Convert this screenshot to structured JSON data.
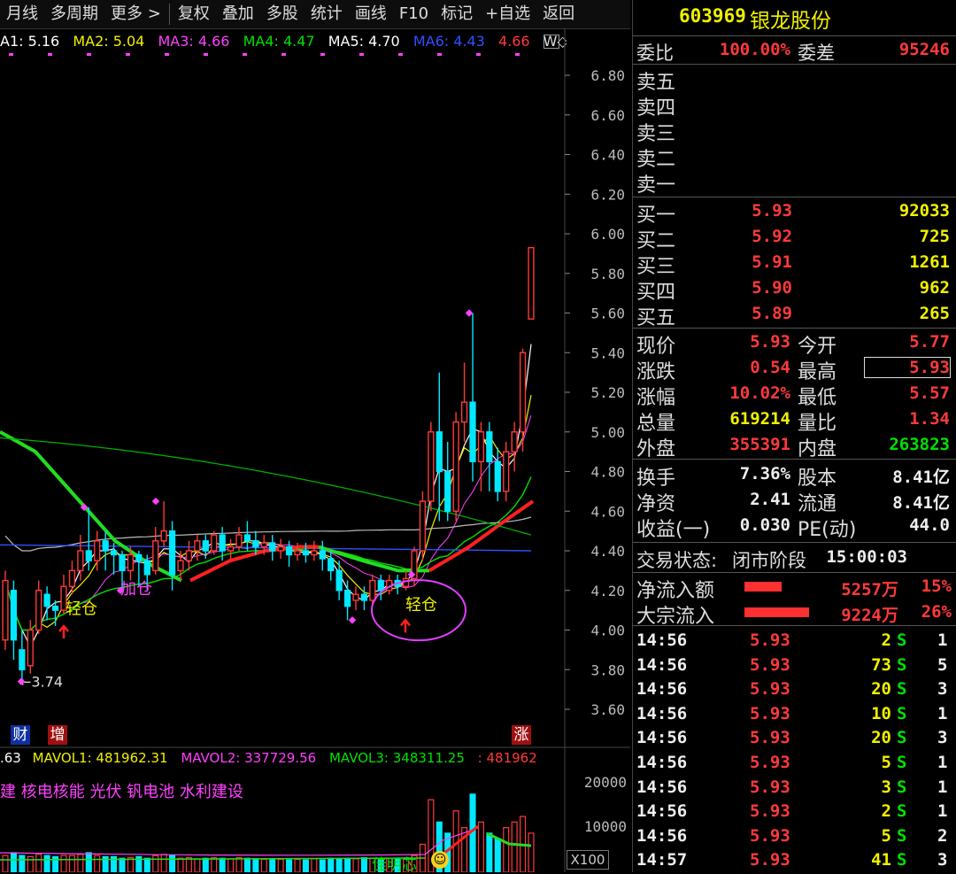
{
  "toolbar": {
    "items": [
      "月线",
      "多周期",
      "更多 >",
      "复权",
      "叠加",
      "多股",
      "统计",
      "画线",
      "F10",
      "标记",
      "+自选",
      "返回"
    ]
  },
  "ma_row": {
    "ma1": "A1: 5.16",
    "ma2": "MA2: 5.04",
    "ma3": "MA3: 4.66",
    "ma4": "MA4: 4.47",
    "ma5": "MA5: 4.70",
    "ma6": "MA6: 4.43",
    "ma7": "4.66",
    "more": "W◇",
    "colors": {
      "ma1": "#ffffff",
      "ma2": "#f0f000",
      "ma3": "#ff40ff",
      "ma4": "#00e000",
      "ma5": "#ffffff",
      "ma6": "#3050ff",
      "ma7": "#ff3a3a"
    }
  },
  "price_axis": [
    "6.80",
    "6.60",
    "6.40",
    "6.20",
    "6.00",
    "5.80",
    "5.60",
    "5.40",
    "5.20",
    "5.00",
    "4.80",
    "4.60",
    "4.40",
    "4.20",
    "4.00",
    "3.80",
    "3.60"
  ],
  "annotations": {
    "low_price": "←3.74",
    "light1": "轻仓",
    "add": "加仓",
    "light2": "轻仓",
    "badge_cai": "财",
    "badge_zeng": "增",
    "badge_zhang": "涨"
  },
  "volume": {
    "mavol_prefix": ".63",
    "mavol1": "MAVOL1: 481962.31",
    "mavol2": "MAVOL2: 337729.56",
    "mavol3": "MAVOL3: 348311.25",
    "mavol4": ": 481962",
    "concepts": "建 核电核能 光伏 钒电池 水利建设",
    "axis_top": "20000",
    "axis_mid": "10000",
    "axis_unit": "X100",
    "bottom_text": "佳明芯"
  },
  "stock": {
    "code": "603969",
    "name": "银龙股份"
  },
  "order_ratio": {
    "wei_bi_label": "委比",
    "wei_bi": "100.00%",
    "wei_cha_label": "委差",
    "wei_cha": "95246"
  },
  "asks": [
    {
      "label": "卖五",
      "price": "",
      "vol": ""
    },
    {
      "label": "卖四",
      "price": "",
      "vol": ""
    },
    {
      "label": "卖三",
      "price": "",
      "vol": ""
    },
    {
      "label": "卖二",
      "price": "",
      "vol": ""
    },
    {
      "label": "卖一",
      "price": "",
      "vol": ""
    }
  ],
  "bids": [
    {
      "label": "买一",
      "price": "5.93",
      "vol": "92033"
    },
    {
      "label": "买二",
      "price": "5.92",
      "vol": "725"
    },
    {
      "label": "买三",
      "price": "5.91",
      "vol": "1261"
    },
    {
      "label": "买四",
      "price": "5.90",
      "vol": "962"
    },
    {
      "label": "买五",
      "price": "5.89",
      "vol": "265"
    }
  ],
  "quote": {
    "xj_l": "现价",
    "xj": "5.93",
    "jk_l": "今开",
    "jk": "5.77",
    "zd_l": "涨跌",
    "zd": "0.54",
    "zg_l": "最高",
    "zg": "5.93",
    "zf_l": "涨幅",
    "zf": "10.02%",
    "zdi_l": "最低",
    "zdi": "5.57",
    "zl_l": "总量",
    "zl": "619214",
    "lb_l": "量比",
    "lb": "1.34",
    "wp_l": "外盘",
    "wp": "355391",
    "np_l": "内盘",
    "np": "263823"
  },
  "fund": {
    "hs_l": "换手",
    "hs": "7.36%",
    "gb_l": "股本",
    "gb": "8.41亿",
    "jz_l": "净资",
    "jz": "2.41",
    "lt_l": "流通",
    "lt": "8.41亿",
    "sy_l": "收益(一)",
    "sy": "0.030",
    "pe_l": "PE(动)",
    "pe": "44.0"
  },
  "trade_status": {
    "label": "交易状态:",
    "state": "闭市阶段",
    "time": "15:00:03"
  },
  "flows": [
    {
      "label": "净流入额",
      "amount": "5257万",
      "pct": "15%",
      "bar": 0.15
    },
    {
      "label": "大宗流入",
      "amount": "9224万",
      "pct": "26%",
      "bar": 0.26
    }
  ],
  "ticks": [
    {
      "time": "14:56",
      "price": "5.93",
      "vol": "2",
      "bs": "S",
      "n": "1"
    },
    {
      "time": "14:56",
      "price": "5.93",
      "vol": "73",
      "bs": "S",
      "n": "5"
    },
    {
      "time": "14:56",
      "price": "5.93",
      "vol": "20",
      "bs": "S",
      "n": "3"
    },
    {
      "time": "14:56",
      "price": "5.93",
      "vol": "10",
      "bs": "S",
      "n": "1"
    },
    {
      "time": "14:56",
      "price": "5.93",
      "vol": "20",
      "bs": "S",
      "n": "3"
    },
    {
      "time": "14:56",
      "price": "5.93",
      "vol": "5",
      "bs": "S",
      "n": "1"
    },
    {
      "time": "14:56",
      "price": "5.93",
      "vol": "3",
      "bs": "S",
      "n": "1"
    },
    {
      "time": "14:56",
      "price": "5.93",
      "vol": "2",
      "bs": "S",
      "n": "1"
    },
    {
      "time": "14:56",
      "price": "5.93",
      "vol": "5",
      "bs": "S",
      "n": "2"
    },
    {
      "time": "14:57",
      "price": "5.93",
      "vol": "41",
      "bs": "S",
      "n": "3"
    }
  ],
  "candles": [
    [
      3.95,
      4.25,
      4.3,
      3.9
    ],
    [
      4.2,
      3.95,
      4.25,
      3.85
    ],
    [
      3.9,
      3.8,
      4.0,
      3.74
    ],
    [
      3.82,
      4.0,
      4.05,
      3.78
    ],
    [
      4.0,
      4.2,
      4.25,
      3.98
    ],
    [
      4.18,
      4.12,
      4.22,
      4.05
    ],
    [
      4.12,
      4.1,
      4.15,
      4.02
    ],
    [
      4.1,
      4.22,
      4.28,
      4.08
    ],
    [
      4.22,
      4.3,
      4.35,
      4.18
    ],
    [
      4.3,
      4.4,
      4.48,
      4.25
    ],
    [
      4.4,
      4.35,
      4.62,
      4.3
    ],
    [
      4.35,
      4.45,
      4.5,
      4.3
    ],
    [
      4.45,
      4.4,
      4.5,
      4.3
    ],
    [
      4.4,
      4.38,
      4.44,
      4.28
    ],
    [
      4.38,
      4.3,
      4.4,
      4.2
    ],
    [
      4.3,
      4.38,
      4.42,
      4.25
    ],
    [
      4.38,
      4.35,
      4.4,
      4.22
    ],
    [
      4.35,
      4.28,
      4.38,
      4.2
    ],
    [
      4.3,
      4.45,
      4.52,
      4.28
    ],
    [
      4.45,
      4.5,
      4.65,
      4.42
    ],
    [
      4.5,
      4.28,
      4.55,
      4.2
    ],
    [
      4.3,
      4.35,
      4.4,
      4.25
    ],
    [
      4.35,
      4.4,
      4.45,
      4.3
    ],
    [
      4.4,
      4.45,
      4.48,
      4.35
    ],
    [
      4.45,
      4.4,
      4.48,
      4.36
    ],
    [
      4.4,
      4.48,
      4.5,
      4.38
    ],
    [
      4.48,
      4.4,
      4.52,
      4.35
    ],
    [
      4.4,
      4.42,
      4.46,
      4.36
    ],
    [
      4.42,
      4.48,
      4.52,
      4.4
    ],
    [
      4.48,
      4.45,
      4.55,
      4.4
    ],
    [
      4.45,
      4.42,
      4.5,
      4.38
    ],
    [
      4.42,
      4.44,
      4.48,
      4.38
    ],
    [
      4.44,
      4.4,
      4.48,
      4.35
    ],
    [
      4.4,
      4.42,
      4.46,
      4.36
    ],
    [
      4.42,
      4.38,
      4.45,
      4.32
    ],
    [
      4.38,
      4.4,
      4.44,
      4.35
    ],
    [
      4.4,
      4.38,
      4.44,
      4.34
    ],
    [
      4.38,
      4.4,
      4.45,
      4.35
    ],
    [
      4.4,
      4.36,
      4.45,
      4.3
    ],
    [
      4.36,
      4.3,
      4.4,
      4.25
    ],
    [
      4.3,
      4.2,
      4.35,
      4.15
    ],
    [
      4.2,
      4.12,
      4.25,
      4.05
    ],
    [
      4.15,
      4.18,
      4.22,
      4.1
    ],
    [
      4.18,
      4.15,
      4.22,
      4.1
    ],
    [
      4.15,
      4.25,
      4.28,
      4.12
    ],
    [
      4.25,
      4.2,
      4.28,
      4.15
    ],
    [
      4.2,
      4.25,
      4.28,
      4.18
    ],
    [
      4.25,
      4.22,
      4.28,
      4.18
    ],
    [
      4.22,
      4.26,
      4.3,
      4.2
    ],
    [
      4.26,
      4.4,
      4.42,
      4.22
    ],
    [
      4.4,
      4.65,
      4.7,
      4.35
    ],
    [
      4.65,
      5.0,
      5.05,
      4.6
    ],
    [
      5.0,
      4.8,
      5.3,
      4.55
    ],
    [
      4.8,
      4.6,
      4.95,
      4.55
    ],
    [
      4.6,
      5.05,
      5.1,
      4.55
    ],
    [
      5.05,
      5.15,
      5.35,
      4.95
    ],
    [
      5.15,
      4.85,
      5.6,
      4.75
    ],
    [
      4.85,
      5.0,
      5.05,
      4.7
    ],
    [
      5.0,
      4.85,
      5.05,
      4.7
    ],
    [
      4.85,
      4.7,
      4.92,
      4.65
    ],
    [
      4.7,
      4.9,
      4.95,
      4.65
    ],
    [
      4.9,
      5.0,
      5.05,
      4.8
    ],
    [
      5.0,
      5.4,
      5.42,
      4.9
    ],
    [
      5.57,
      5.93,
      5.93,
      5.57
    ]
  ]
}
